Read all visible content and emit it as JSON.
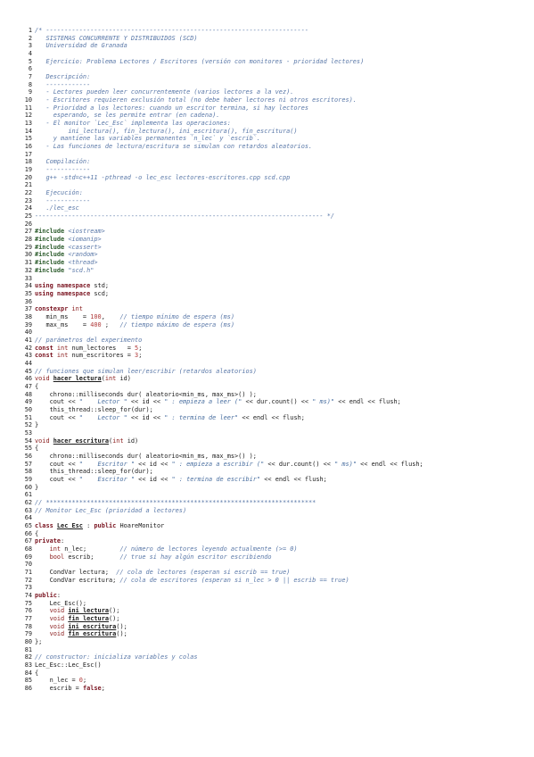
{
  "document": {
    "lines": [
      {
        "n": "1",
        "t": [
          {
            "c": "comment",
            "s": "/* -----------------------------------------------------------------------"
          }
        ]
      },
      {
        "n": "2",
        "t": [
          {
            "c": "comment",
            "s": "   SISTEMAS CONCURRENTE Y DISTRIBUIDOS (SCD)"
          }
        ]
      },
      {
        "n": "3",
        "t": [
          {
            "c": "comment",
            "s": "   Universidad de Granada"
          }
        ]
      },
      {
        "n": "4",
        "t": []
      },
      {
        "n": "5",
        "t": [
          {
            "c": "comment",
            "s": "   Ejercicio: Problema Lectores / Escritores (versión con monitores - prioridad lectores)"
          }
        ]
      },
      {
        "n": "6",
        "t": []
      },
      {
        "n": "7",
        "t": [
          {
            "c": "comment",
            "s": "   Descripción:"
          }
        ]
      },
      {
        "n": "8",
        "t": [
          {
            "c": "comment",
            "s": "   ------------"
          }
        ]
      },
      {
        "n": "9",
        "t": [
          {
            "c": "comment",
            "s": "   - Lectores pueden leer concurrentemente (varios lectores a la vez)."
          }
        ]
      },
      {
        "n": "10",
        "t": [
          {
            "c": "comment",
            "s": "   - Escritores requieren exclusión total (no debe haber lectores ni otros escritores)."
          }
        ]
      },
      {
        "n": "11",
        "t": [
          {
            "c": "comment",
            "s": "   - Prioridad a los lectores: cuando un escritor termina, si hay lectores"
          }
        ]
      },
      {
        "n": "12",
        "t": [
          {
            "c": "comment",
            "s": "     esperando, se les permite entrar (en cadena)."
          }
        ]
      },
      {
        "n": "13",
        "t": [
          {
            "c": "comment",
            "s": "   - El monitor `Lec_Esc` implementa las operaciones:"
          }
        ]
      },
      {
        "n": "14",
        "t": [
          {
            "c": "comment",
            "s": "         ini_lectura(), fin_lectura(), ini_escritura(), fin_escritura()"
          }
        ]
      },
      {
        "n": "15",
        "t": [
          {
            "c": "comment",
            "s": "     y mantiene las variables permanentes `n_lec` y `escrib`."
          }
        ]
      },
      {
        "n": "16",
        "t": [
          {
            "c": "comment",
            "s": "   - Las funciones de lectura/escritura se simulan con retardos aleatorios."
          }
        ]
      },
      {
        "n": "17",
        "t": []
      },
      {
        "n": "18",
        "t": [
          {
            "c": "comment",
            "s": "   Compilación:"
          }
        ]
      },
      {
        "n": "19",
        "t": [
          {
            "c": "comment",
            "s": "   ------------"
          }
        ]
      },
      {
        "n": "20",
        "t": [
          {
            "c": "comment",
            "s": "   g++ -std=c++11 -pthread -o lec_esc lectores-escritores.cpp scd.cpp"
          }
        ]
      },
      {
        "n": "21",
        "t": []
      },
      {
        "n": "22",
        "t": [
          {
            "c": "comment",
            "s": "   Ejecución:"
          }
        ]
      },
      {
        "n": "23",
        "t": [
          {
            "c": "comment",
            "s": "   ------------"
          }
        ]
      },
      {
        "n": "24",
        "t": [
          {
            "c": "comment",
            "s": "   ./lec_esc"
          }
        ]
      },
      {
        "n": "25",
        "t": [
          {
            "c": "comment",
            "s": "------------------------------------------------------------------------------ */"
          }
        ]
      },
      {
        "n": "26",
        "t": []
      },
      {
        "n": "27",
        "t": [
          {
            "c": "preproc",
            "s": "#include "
          },
          {
            "c": "include",
            "s": "<iostream>"
          }
        ]
      },
      {
        "n": "28",
        "t": [
          {
            "c": "preproc",
            "s": "#include "
          },
          {
            "c": "include",
            "s": "<iomanip>"
          }
        ]
      },
      {
        "n": "29",
        "t": [
          {
            "c": "preproc",
            "s": "#include "
          },
          {
            "c": "include",
            "s": "<cassert>"
          }
        ]
      },
      {
        "n": "30",
        "t": [
          {
            "c": "preproc",
            "s": "#include "
          },
          {
            "c": "include",
            "s": "<random>"
          }
        ]
      },
      {
        "n": "31",
        "t": [
          {
            "c": "preproc",
            "s": "#include "
          },
          {
            "c": "include",
            "s": "<thread>"
          }
        ]
      },
      {
        "n": "32",
        "t": [
          {
            "c": "preproc",
            "s": "#include "
          },
          {
            "c": "include",
            "s": "\"scd.h\""
          }
        ]
      },
      {
        "n": "33",
        "t": []
      },
      {
        "n": "34",
        "t": [
          {
            "c": "keyword",
            "s": "using namespace "
          },
          {
            "c": "normal",
            "s": "std;"
          }
        ]
      },
      {
        "n": "35",
        "t": [
          {
            "c": "keyword",
            "s": "using namespace "
          },
          {
            "c": "normal",
            "s": "scd;"
          }
        ]
      },
      {
        "n": "36",
        "t": []
      },
      {
        "n": "37",
        "t": [
          {
            "c": "keyword",
            "s": "constexpr "
          },
          {
            "c": "type",
            "s": "int"
          }
        ]
      },
      {
        "n": "38",
        "t": [
          {
            "c": "normal",
            "s": "   min_ms    = "
          },
          {
            "c": "number",
            "s": "100"
          },
          {
            "c": "normal",
            "s": ",    "
          },
          {
            "c": "comment",
            "s": "// tiempo mínimo de espera (ms)"
          }
        ]
      },
      {
        "n": "39",
        "t": [
          {
            "c": "normal",
            "s": "   max_ms    = "
          },
          {
            "c": "number",
            "s": "400"
          },
          {
            "c": "normal",
            "s": " ;   "
          },
          {
            "c": "comment",
            "s": "// tiempo máximo de espera (ms)"
          }
        ]
      },
      {
        "n": "40",
        "t": []
      },
      {
        "n": "41",
        "t": [
          {
            "c": "comment",
            "s": "// parámetros del experimento"
          }
        ]
      },
      {
        "n": "42",
        "t": [
          {
            "c": "keyword",
            "s": "const "
          },
          {
            "c": "type",
            "s": "int "
          },
          {
            "c": "normal",
            "s": "num_lectores   = "
          },
          {
            "c": "number",
            "s": "5"
          },
          {
            "c": "normal",
            "s": ";"
          }
        ]
      },
      {
        "n": "43",
        "t": [
          {
            "c": "keyword",
            "s": "const "
          },
          {
            "c": "type",
            "s": "int "
          },
          {
            "c": "normal",
            "s": "num_escritores = "
          },
          {
            "c": "number",
            "s": "3"
          },
          {
            "c": "normal",
            "s": ";"
          }
        ]
      },
      {
        "n": "44",
        "t": []
      },
      {
        "n": "45",
        "t": [
          {
            "c": "comment",
            "s": "// funciones que simulan leer/escribir (retardos aleatorios)"
          }
        ]
      },
      {
        "n": "46",
        "t": [
          {
            "c": "type",
            "s": "void "
          },
          {
            "c": "func",
            "s": "hacer_lectura"
          },
          {
            "c": "normal",
            "s": "("
          },
          {
            "c": "type",
            "s": "int "
          },
          {
            "c": "normal",
            "s": "id)"
          }
        ]
      },
      {
        "n": "47",
        "t": [
          {
            "c": "normal",
            "s": "{"
          }
        ]
      },
      {
        "n": "48",
        "t": [
          {
            "c": "normal",
            "s": "    chrono::milliseconds dur( aleatorio<min_ms, max_ms>() );"
          }
        ]
      },
      {
        "n": "49",
        "t": [
          {
            "c": "normal",
            "s": "    cout << "
          },
          {
            "c": "string",
            "s": "\"    Lector \""
          },
          {
            "c": "normal",
            "s": " << id << "
          },
          {
            "c": "string",
            "s": "\" : empieza a leer (\""
          },
          {
            "c": "normal",
            "s": " << dur.count() << "
          },
          {
            "c": "string",
            "s": "\" ms)\""
          },
          {
            "c": "normal",
            "s": " << endl << flush;"
          }
        ]
      },
      {
        "n": "50",
        "t": [
          {
            "c": "normal",
            "s": "    this_thread::sleep_for(dur);"
          }
        ]
      },
      {
        "n": "51",
        "t": [
          {
            "c": "normal",
            "s": "    cout << "
          },
          {
            "c": "string",
            "s": "\"    Lector \""
          },
          {
            "c": "normal",
            "s": " << id << "
          },
          {
            "c": "string",
            "s": "\" : termina de leer\""
          },
          {
            "c": "normal",
            "s": " << endl << flush;"
          }
        ]
      },
      {
        "n": "52",
        "t": [
          {
            "c": "normal",
            "s": "}"
          }
        ]
      },
      {
        "n": "53",
        "t": []
      },
      {
        "n": "54",
        "t": [
          {
            "c": "type",
            "s": "void "
          },
          {
            "c": "func",
            "s": "hacer_escritura"
          },
          {
            "c": "normal",
            "s": "("
          },
          {
            "c": "type",
            "s": "int "
          },
          {
            "c": "normal",
            "s": "id)"
          }
        ]
      },
      {
        "n": "55",
        "t": [
          {
            "c": "normal",
            "s": "{"
          }
        ]
      },
      {
        "n": "56",
        "t": [
          {
            "c": "normal",
            "s": "    chrono::milliseconds dur( aleatorio<min_ms, max_ms>() );"
          }
        ]
      },
      {
        "n": "57",
        "t": [
          {
            "c": "normal",
            "s": "    cout << "
          },
          {
            "c": "string",
            "s": "\"    Escritor \""
          },
          {
            "c": "normal",
            "s": " << id << "
          },
          {
            "c": "string",
            "s": "\" : empieza a escribir (\""
          },
          {
            "c": "normal",
            "s": " << dur.count() << "
          },
          {
            "c": "string",
            "s": "\" ms)\""
          },
          {
            "c": "normal",
            "s": " << endl << flush;"
          }
        ]
      },
      {
        "n": "58",
        "t": [
          {
            "c": "normal",
            "s": "    this_thread::sleep_for(dur);"
          }
        ]
      },
      {
        "n": "59",
        "t": [
          {
            "c": "normal",
            "s": "    cout << "
          },
          {
            "c": "string",
            "s": "\"    Escritor \""
          },
          {
            "c": "normal",
            "s": " << id << "
          },
          {
            "c": "string",
            "s": "\" : termina de escribir\""
          },
          {
            "c": "normal",
            "s": " << endl << flush;"
          }
        ]
      },
      {
        "n": "60",
        "t": [
          {
            "c": "normal",
            "s": "}"
          }
        ]
      },
      {
        "n": "61",
        "t": []
      },
      {
        "n": "62",
        "t": [
          {
            "c": "comment",
            "s": "// *************************************************************************"
          }
        ]
      },
      {
        "n": "63",
        "t": [
          {
            "c": "comment",
            "s": "// Monitor Lec_Esc (prioridad a lectores)"
          }
        ]
      },
      {
        "n": "64",
        "t": []
      },
      {
        "n": "65",
        "t": [
          {
            "c": "keyword",
            "s": "class "
          },
          {
            "c": "func",
            "s": "Lec_Esc"
          },
          {
            "c": "normal",
            "s": " : "
          },
          {
            "c": "keyword",
            "s": "public "
          },
          {
            "c": "normal",
            "s": "HoareMonitor"
          }
        ]
      },
      {
        "n": "66",
        "t": [
          {
            "c": "normal",
            "s": "{"
          }
        ]
      },
      {
        "n": "67",
        "t": [
          {
            "c": "keyword",
            "s": "private"
          },
          {
            "c": "normal",
            "s": ":"
          }
        ]
      },
      {
        "n": "68",
        "t": [
          {
            "c": "normal",
            "s": "    "
          },
          {
            "c": "type",
            "s": "int "
          },
          {
            "c": "normal",
            "s": "n_lec;         "
          },
          {
            "c": "comment",
            "s": "// número de lectores leyendo actualmente (>= 0)"
          }
        ]
      },
      {
        "n": "69",
        "t": [
          {
            "c": "normal",
            "s": "    "
          },
          {
            "c": "type",
            "s": "bool "
          },
          {
            "c": "normal",
            "s": "escrib;       "
          },
          {
            "c": "comment",
            "s": "// true si hay algún escritor escribiendo"
          }
        ]
      },
      {
        "n": "70",
        "t": []
      },
      {
        "n": "71",
        "t": [
          {
            "c": "normal",
            "s": "    CondVar lectura;  "
          },
          {
            "c": "comment",
            "s": "// cola de lectores (esperan si escrib == true)"
          }
        ]
      },
      {
        "n": "72",
        "t": [
          {
            "c": "normal",
            "s": "    CondVar escritura; "
          },
          {
            "c": "comment",
            "s": "// cola de escritores (esperan si n_lec > 0 || escrib == true)"
          }
        ]
      },
      {
        "n": "73",
        "t": []
      },
      {
        "n": "74",
        "t": [
          {
            "c": "keyword",
            "s": "public"
          },
          {
            "c": "normal",
            "s": ":"
          }
        ]
      },
      {
        "n": "75",
        "t": [
          {
            "c": "normal",
            "s": "    Lec_Esc();"
          }
        ]
      },
      {
        "n": "76",
        "t": [
          {
            "c": "normal",
            "s": "    "
          },
          {
            "c": "type",
            "s": "void "
          },
          {
            "c": "func",
            "s": "ini_lectura"
          },
          {
            "c": "normal",
            "s": "();"
          }
        ]
      },
      {
        "n": "77",
        "t": [
          {
            "c": "normal",
            "s": "    "
          },
          {
            "c": "type",
            "s": "void "
          },
          {
            "c": "func",
            "s": "fin_lectura"
          },
          {
            "c": "normal",
            "s": "();"
          }
        ]
      },
      {
        "n": "78",
        "t": [
          {
            "c": "normal",
            "s": "    "
          },
          {
            "c": "type",
            "s": "void "
          },
          {
            "c": "func",
            "s": "ini_escritura"
          },
          {
            "c": "normal",
            "s": "();"
          }
        ]
      },
      {
        "n": "79",
        "t": [
          {
            "c": "normal",
            "s": "    "
          },
          {
            "c": "type",
            "s": "void "
          },
          {
            "c": "func",
            "s": "fin_escritura"
          },
          {
            "c": "normal",
            "s": "();"
          }
        ]
      },
      {
        "n": "80",
        "t": [
          {
            "c": "normal",
            "s": "};"
          }
        ]
      },
      {
        "n": "81",
        "t": []
      },
      {
        "n": "82",
        "t": [
          {
            "c": "comment",
            "s": "// constructor: inicializa variables y colas"
          }
        ]
      },
      {
        "n": "83",
        "t": [
          {
            "c": "normal",
            "s": "Lec_Esc::Lec_Esc()"
          }
        ]
      },
      {
        "n": "84",
        "t": [
          {
            "c": "normal",
            "s": "{"
          }
        ]
      },
      {
        "n": "85",
        "t": [
          {
            "c": "normal",
            "s": "    n_lec = "
          },
          {
            "c": "number",
            "s": "0"
          },
          {
            "c": "normal",
            "s": ";"
          }
        ]
      },
      {
        "n": "86",
        "t": [
          {
            "c": "normal",
            "s": "    escrib = "
          },
          {
            "c": "keyword",
            "s": "false"
          },
          {
            "c": "normal",
            "s": ";"
          }
        ]
      }
    ]
  }
}
